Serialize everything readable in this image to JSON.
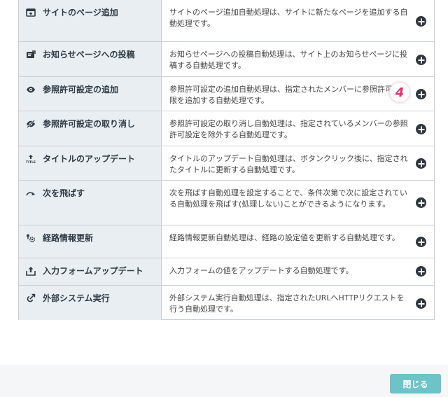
{
  "actions": [
    {
      "name": "サイトのページ追加",
      "icon": "page-add-icon",
      "desc": "サイトのページ追加自動処理は、サイトに新たなページを追加する自動処理です。"
    },
    {
      "name": "お知らせページへの投稿",
      "icon": "notice-post-icon",
      "desc": "お知らせページへの投稿自動処理は、サイト上のお知らせページに投稿する自動処理です。"
    },
    {
      "name": "参照許可設定の追加",
      "icon": "eye-icon",
      "desc": "参照許可設定の追加自動処理は、指定されたメンバーに参照許可の権限を追加する自動処理です。"
    },
    {
      "name": "参照許可設定の取り消し",
      "icon": "eye-slash-icon",
      "desc": "参照許可設定の取り消し自動処理は、指定されているメンバーの参照許可設定を除外する自動処理です。"
    },
    {
      "name": "タイトルのアップデート",
      "icon": "title-update-icon",
      "desc": "タイトルのアップデート自動処理は、ボタンクリック後に、指定されたタイトルに更新する自動処理です。"
    },
    {
      "name": "次を飛ばす",
      "icon": "skip-arrow-icon",
      "desc": "次を飛ばす自動処理を設定することで、条件次第で次に設定されている自動処理を飛ばす(処理しない)ことができるようになります。"
    },
    {
      "name": "経路情報更新",
      "icon": "route-settings-icon",
      "desc": "経路情報更新自動処理は、経路の設定値を更新する自動処理です。"
    },
    {
      "name": "入力フォームアップデート",
      "icon": "form-upload-icon",
      "desc": "入力フォームの値をアップデートする自動処理です。"
    },
    {
      "name": "外部システム実行",
      "icon": "external-link-icon",
      "desc": "外部システム実行自動処理は、指定されたURLへHTTPリクエストを行う自動処理です。"
    }
  ],
  "step_badge": "4",
  "footer": {
    "close_label": "閉じる"
  },
  "colors": {
    "name_bg": "#e9eef3",
    "close_btn": "#6cc3c8",
    "badge": "#e8306a"
  }
}
